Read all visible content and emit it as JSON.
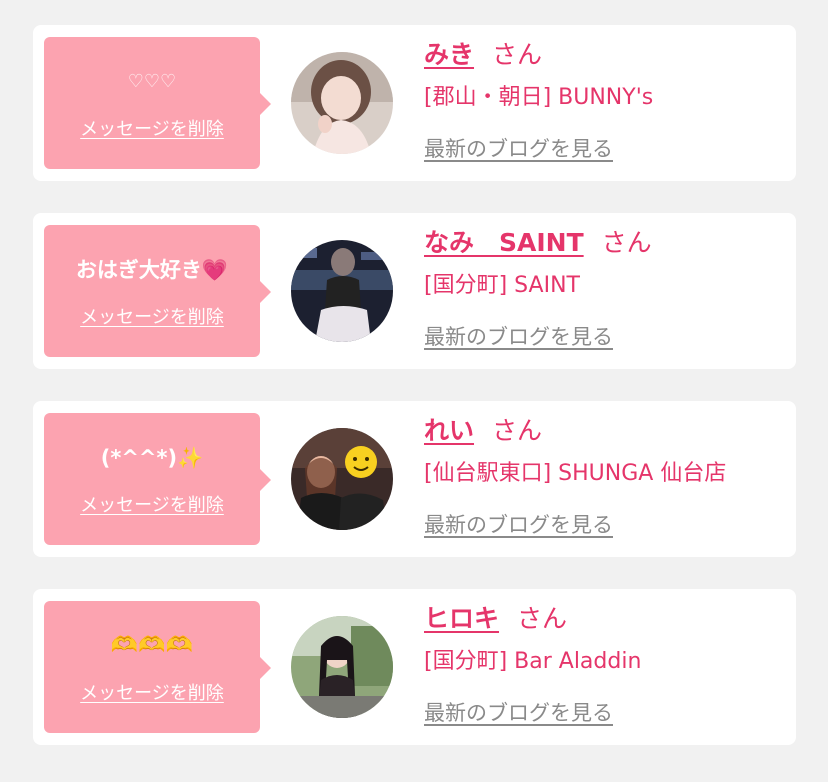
{
  "colors": {
    "background": "#f1f1f1",
    "card": "#ffffff",
    "bubble": "#fca3b0",
    "accent": "#e5356a",
    "link_gray": "#8a8a8a"
  },
  "entries": [
    {
      "message": "♡♡♡",
      "delete_label": "メッセージを削除",
      "name": "みき",
      "honorific": "さん",
      "shop": "[郡山・朝日] BUNNY's",
      "blog_link": "最新のブログを見る",
      "avatar_icon": "avatar-photo-miki"
    },
    {
      "message": "おはぎ大好き💗",
      "delete_label": "メッセージを削除",
      "name": "なみ　SAINT",
      "honorific": "さん",
      "shop": "[国分町] SAINT",
      "blog_link": "最新のブログを見る",
      "avatar_icon": "avatar-photo-nami"
    },
    {
      "message": "(*^^*)✨",
      "delete_label": "メッセージを削除",
      "name": "れい",
      "honorific": "さん",
      "shop": "[仙台駅東口] SHUNGA 仙台店",
      "blog_link": "最新のブログを見る",
      "avatar_icon": "avatar-photo-rei"
    },
    {
      "message": "🫶🫶🫶",
      "delete_label": "メッセージを削除",
      "name": "ヒロキ",
      "honorific": "さん",
      "shop": "[国分町] Bar Aladdin",
      "blog_link": "最新のブログを見る",
      "avatar_icon": "avatar-photo-hiroki"
    }
  ]
}
